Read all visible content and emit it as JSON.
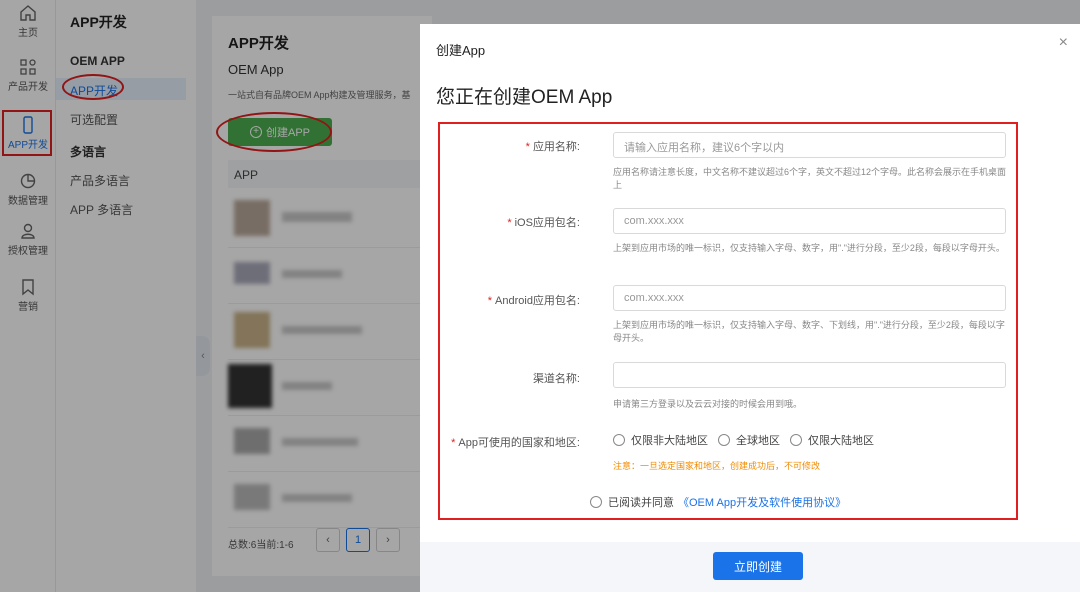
{
  "rail": {
    "items": [
      {
        "label": "主页",
        "icon": "home-icon"
      },
      {
        "label": "产品开发",
        "icon": "grid-icon"
      },
      {
        "label": "APP开发",
        "icon": "phone-icon"
      },
      {
        "label": "数据管理",
        "icon": "pie-chart-icon"
      },
      {
        "label": "授权管理",
        "icon": "user-icon"
      },
      {
        "label": "营销",
        "icon": "bookmark-icon"
      }
    ],
    "active": "APP开发"
  },
  "subnav": {
    "title": "APP开发",
    "groups": [
      {
        "label": "OEM APP",
        "items": [
          "APP开发",
          "可选配置"
        ]
      },
      {
        "label": "多语言",
        "items": [
          "产品多语言",
          "APP 多语言"
        ]
      }
    ],
    "active": "APP开发"
  },
  "main": {
    "title": "APP开发",
    "subtitle": "OEM App",
    "description": "一站式自有品牌OEM App构建及管理服务，基",
    "create_button": "创建APP",
    "table_header": "APP",
    "pagination": {
      "summary": "总数:6当前:1-6",
      "current_page": "1"
    }
  },
  "modal": {
    "title": "创建App",
    "close": "×",
    "heading": "您正在创建OEM App",
    "fields": [
      {
        "label": "应用名称:",
        "required": true,
        "placeholder": "请输入应用名称，建议6个字以内",
        "hint": "应用名称请注意长度，中文名称不建议超过6个字，英文不超过12个字母。此名称会展示在手机桌面上"
      },
      {
        "label": "iOS应用包名:",
        "required": true,
        "placeholder": "com.xxx.xxx",
        "hint": "上架到应用市场的唯一标识，仅支持输入字母、数字，用\".\"进行分段，至少2段，每段以字母开头。"
      },
      {
        "label": "Android应用包名:",
        "required": true,
        "placeholder": "com.xxx.xxx",
        "hint": "上架到应用市场的唯一标识，仅支持输入字母、数字、下划线，用\".\"进行分段，至少2段，每段以字母开头。"
      },
      {
        "label": "渠道名称:",
        "required": false,
        "placeholder": "",
        "hint": "申请第三方登录以及云云对接的时候会用到哦。"
      }
    ],
    "region": {
      "label": "App可使用的国家和地区:",
      "options": [
        "仅限非大陆地区",
        "全球地区",
        "仅限大陆地区"
      ],
      "warning": "注意：一旦选定国家和地区，创建成功后，不可修改"
    },
    "agreement": {
      "text": "已阅读并同意",
      "link": "《OEM App开发及软件使用协议》"
    },
    "submit": "立即创建"
  },
  "colors": {
    "accent": "#1a73e8",
    "annotation": "#e02020",
    "create_green": "#4caf50",
    "warning": "#f08c00"
  }
}
